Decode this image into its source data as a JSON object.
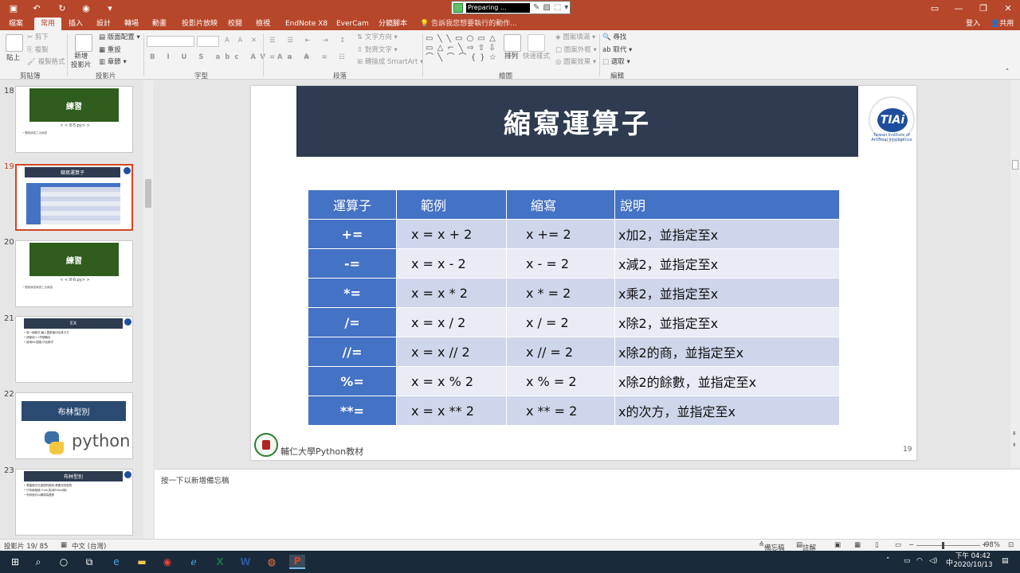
{
  "window": {
    "preparing_text": "Preparing ..."
  },
  "ribbon_tabs": [
    "檔案",
    "常用",
    "插入",
    "設計",
    "轉場",
    "動畫",
    "投影片放映",
    "校閱",
    "檢視",
    "EndNote X8",
    "EverCam",
    "分鏡腳本"
  ],
  "tell_me": "告訴我您想要執行的動作...",
  "account": {
    "signin": "登入",
    "share": "共用"
  },
  "ribbon": {
    "clipboard": {
      "paste": "貼上",
      "cut": "剪下",
      "copy": "複製",
      "format_painter": "複製格式",
      "label": "剪貼簿"
    },
    "slides": {
      "new_slide": "新增\n投影片",
      "layout": "版面配置",
      "reset": "重設",
      "section": "章節",
      "label": "投影片"
    },
    "font": {
      "label": "字型"
    },
    "paragraph": {
      "text_direction": "文字方向",
      "align_text": "對齊文字",
      "convert_smartart": "轉換成 SmartArt",
      "label": "段落"
    },
    "drawing": {
      "arrange": "排列",
      "quick_styles": "快速樣式",
      "shape_fill": "圖案填滿",
      "shape_outline": "圖案外框",
      "shape_effects": "圖案效果",
      "label": "繪圖"
    },
    "editing": {
      "find": "尋找",
      "replace": "取代",
      "select": "選取",
      "label": "編輯"
    }
  },
  "thumbnails": [
    {
      "num": "18",
      "title": "練習",
      "sub": "< < 8-5.py> >",
      "note": "• 體驗練習工出練習"
    },
    {
      "num": "19",
      "title": "縮寫運算子"
    },
    {
      "num": "20",
      "title": "練習",
      "sub": "< < 8-6.py> >",
      "note": "• 體驗練習練習工出練習"
    },
    {
      "num": "21",
      "title": "EX",
      "lines": [
        "• 寫一個程式,輸入整數值印出其平方",
        "• 請使用++符號輸出",
        "• 使用for迴圈,印出數字"
      ]
    },
    {
      "num": "22",
      "title": "布林型別",
      "brand": "python"
    },
    {
      "num": "23",
      "title": "布林型別",
      "lines": [
        "• 電腦程式在處理判斷時,需要布林型別",
        "• 只有兩個值:True(真)和False(假)",
        "• 布林值可以轉換為整數"
      ]
    }
  ],
  "slide": {
    "title": "縮寫運算子",
    "logo_text": "TIAi",
    "logo_ring": "Taiwan Institute of Artificial Intelligence",
    "headers": [
      "運算子",
      "範例",
      "縮寫",
      "說明"
    ],
    "rows": [
      [
        "+=",
        "x = x + 2",
        "x += 2",
        "x加2，並指定至x"
      ],
      [
        "-=",
        "x = x - 2",
        "x - = 2",
        "x減2，並指定至x"
      ],
      [
        "*=",
        "x = x * 2",
        "x * = 2",
        "x乘2，並指定至x"
      ],
      [
        "/=",
        "x = x / 2",
        "x / = 2",
        "x除2，並指定至x"
      ],
      [
        "//=",
        "x = x // 2",
        "x // = 2",
        "x除2的商，並指定至x"
      ],
      [
        "%=",
        "x = x % 2",
        "x % = 2",
        "x除2的餘數，並指定至x"
      ],
      [
        "**=",
        "x = x ** 2",
        "x ** = 2",
        "x的次方，並指定至x"
      ]
    ],
    "footer": "輔仁大學Python教材",
    "number": "19"
  },
  "notes_placeholder": "按一下以新增備忘稿",
  "status": {
    "slide": "投影片 19/ 85",
    "language": "中文 (台灣)",
    "notes": "備忘稿",
    "comments": "註解",
    "zoom": "98%"
  },
  "taskbar": {
    "ime": "中",
    "time": "下午 04:42",
    "date": "2020/10/13"
  }
}
